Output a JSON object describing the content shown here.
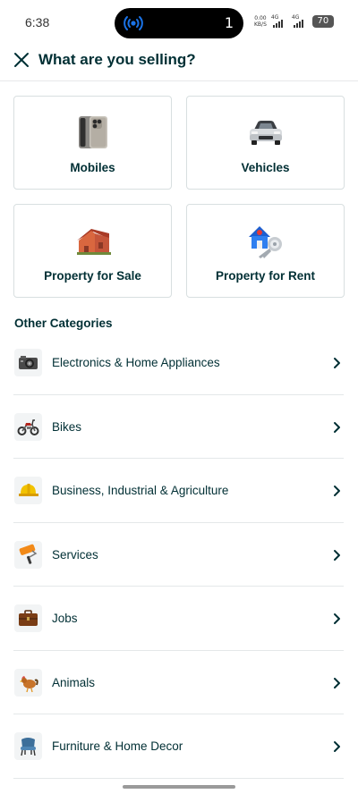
{
  "status_bar": {
    "time": "6:38",
    "notification_count": "1",
    "net_speed_value": "0.00",
    "net_speed_unit": "KB/S",
    "signal1_label": "4G",
    "signal2_label": "4G",
    "battery": "70"
  },
  "header": {
    "title": "What are you selling?",
    "close_icon": "close-icon"
  },
  "main_categories": [
    {
      "label": "Mobiles",
      "icon": "mobile-phone-icon"
    },
    {
      "label": "Vehicles",
      "icon": "car-icon"
    },
    {
      "label": "Property for Sale",
      "icon": "house-icon"
    },
    {
      "label": "Property for Rent",
      "icon": "house-key-icon"
    }
  ],
  "other_categories": {
    "title": "Other Categories",
    "items": [
      {
        "label": "Electronics & Home Appliances",
        "icon": "camera-icon"
      },
      {
        "label": "Bikes",
        "icon": "motorbike-icon"
      },
      {
        "label": "Business, Industrial & Agriculture",
        "icon": "hard-hat-icon"
      },
      {
        "label": "Services",
        "icon": "paint-roller-icon"
      },
      {
        "label": "Jobs",
        "icon": "briefcase-icon"
      },
      {
        "label": "Animals",
        "icon": "rooster-icon"
      },
      {
        "label": "Furniture & Home Decor",
        "icon": "chair-icon"
      }
    ]
  }
}
